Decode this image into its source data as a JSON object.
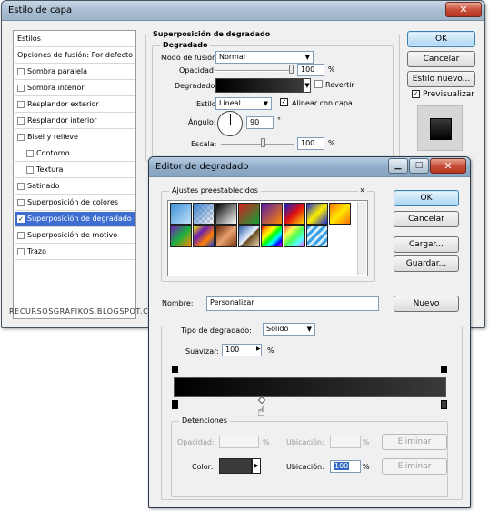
{
  "layer_style": {
    "title": "Estilo de capa",
    "close_glyph": "✕",
    "styles_list": [
      {
        "label": "Estilos",
        "type": "header"
      },
      {
        "label": "Opciones de fusión: Por defecto",
        "type": "item"
      },
      {
        "label": "Sombra paralela",
        "checked": false
      },
      {
        "label": "Sombra interior",
        "checked": false
      },
      {
        "label": "Resplandor exterior",
        "checked": false
      },
      {
        "label": "Resplandor interior",
        "checked": false
      },
      {
        "label": "Bisel y relieve",
        "checked": false
      },
      {
        "label": "Contorno",
        "checked": false,
        "indent": true
      },
      {
        "label": "Textura",
        "checked": false,
        "indent": true
      },
      {
        "label": "Satinado",
        "checked": false
      },
      {
        "label": "Superposición de colores",
        "checked": false
      },
      {
        "label": "Superposición de degradado",
        "checked": true,
        "selected": true
      },
      {
        "label": "Superposición de motivo",
        "checked": false
      },
      {
        "label": "Trazo",
        "checked": false
      }
    ],
    "section_title": "Superposición de degradado",
    "group_title": "Degradado",
    "blend_mode_label": "Modo de fusión:",
    "blend_mode_value": "Normal",
    "opacity_label": "Opacidad:",
    "opacity_value": "100",
    "opacity_level": 1.0,
    "percent": "%",
    "gradient_label": "Degradado:",
    "reverse_label": "Revertir",
    "reverse_checked": false,
    "style_label": "Estilo:",
    "style_value": "Lineal",
    "align_label": "Alinear con capa",
    "align_checked": true,
    "angle_label": "Ángulo:",
    "angle_value": "90",
    "degree": "°",
    "scale_label": "Escala:",
    "scale_value": "100",
    "scale_level": 0.5,
    "buttons": {
      "ok": "OK",
      "cancel": "Cancelar",
      "new_style": "Estilo nuevo..."
    },
    "preview_label": "Previsualizar",
    "preview_checked": true,
    "watermark": "RECURSOSGRAFIKOS.BLOGSPOT.COM"
  },
  "gradient_editor": {
    "title": "Editor de degradado",
    "close_glyph": "✕",
    "presets_label": "Ajustes preestablecidos",
    "presets_menu": "»",
    "buttons": {
      "ok": "OK",
      "cancel": "Cancelar",
      "load": "Cargar...",
      "save": "Guardar...",
      "new": "Nuevo"
    },
    "name_label": "Nombre:",
    "name_value": "Personalizar",
    "type_label": "Tipo de degradado:",
    "type_value": "Sólido",
    "smooth_label": "Suavizar:",
    "smooth_value": "100",
    "percent": "%",
    "stops_title": "Detenciones",
    "opacity_label": "Opacidad:",
    "location_label": "Ubicación:",
    "delete_label": "Eliminar",
    "color_label": "Color:",
    "location_value": "100",
    "colors": {
      "start": "#000000",
      "end": "#3a3a3a"
    }
  }
}
